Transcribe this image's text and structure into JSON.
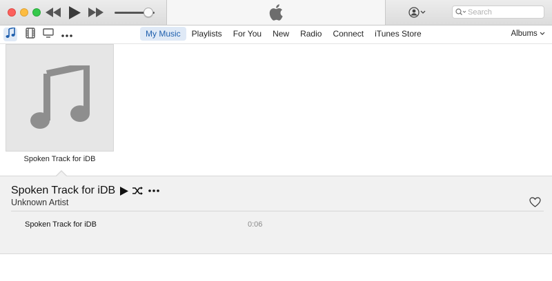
{
  "window": {
    "traffic_lights": [
      "close",
      "minimize",
      "zoom"
    ]
  },
  "player": {
    "icons": [
      "rewind-icon",
      "play-icon",
      "fast-forward-icon"
    ],
    "volume_level": 0.85,
    "lcd_icon": "apple-logo-icon"
  },
  "account": {
    "icon": "account-icon"
  },
  "search": {
    "placeholder": "Search"
  },
  "media_kinds": [
    "music-icon",
    "movies-icon",
    "tv-icon",
    "more-icon"
  ],
  "tabs": [
    {
      "label": "My Music",
      "active": true
    },
    {
      "label": "Playlists"
    },
    {
      "label": "For You"
    },
    {
      "label": "New"
    },
    {
      "label": "Radio"
    },
    {
      "label": "Connect"
    },
    {
      "label": "iTunes Store"
    }
  ],
  "view_selector": {
    "label": "Albums"
  },
  "album": {
    "title": "Spoken Track for iDB",
    "artwork_icon": "music-note-icon"
  },
  "detail": {
    "title": "Spoken Track for iDB",
    "artist": "Unknown Artist",
    "tracks": [
      {
        "name": "Spoken Track for iDB",
        "time": "0:06"
      }
    ]
  },
  "colors": {
    "accent": "#1f5fad",
    "tab_active_bg": "#dfe9f6"
  }
}
